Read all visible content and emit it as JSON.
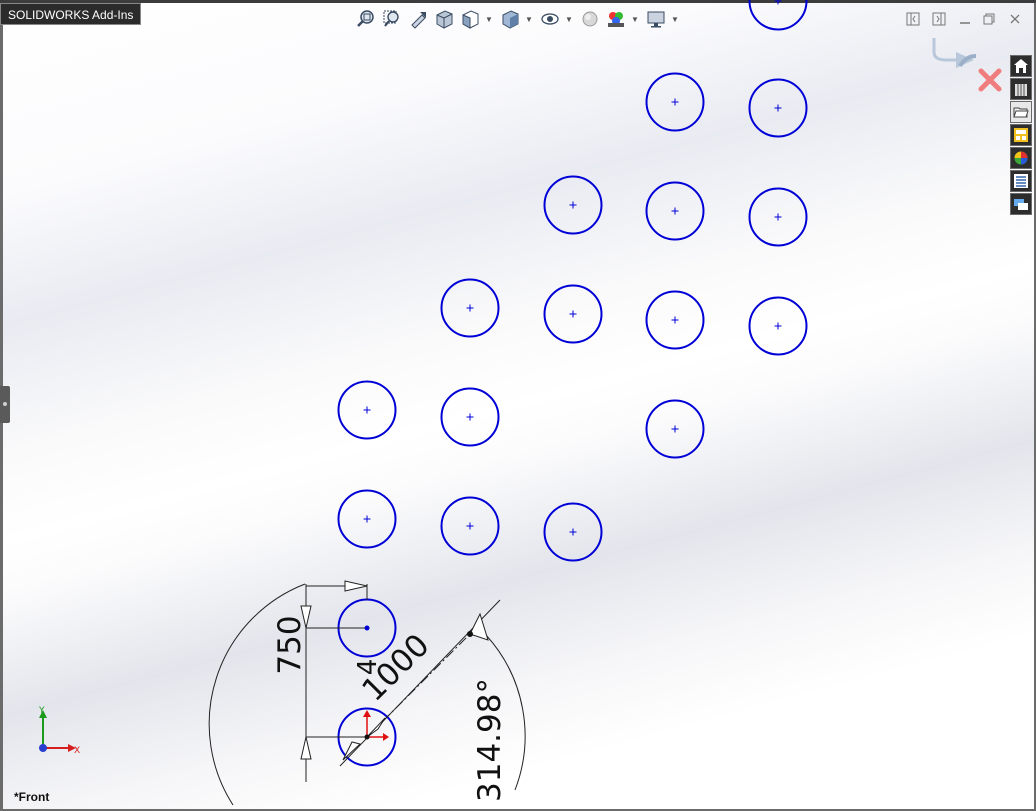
{
  "addins_tab": "SOLIDWORKS Add-Ins",
  "view_label": "*Front",
  "triad": {
    "x_label": "X",
    "y_label": "Y"
  },
  "dimensions": {
    "vertical": "750",
    "linear": "1000",
    "angle": "314.98°",
    "count": "4"
  },
  "heads_up_toolbar": [
    "zoom-to-fit-icon",
    "zoom-to-area-icon",
    "previous-view-icon",
    "section-view-icon",
    "view-orientation-icon",
    "display-style-icon",
    "hide-show-items-icon",
    "edit-appearance-icon",
    "apply-scene-icon",
    "view-settings-icon"
  ],
  "task_pane": [
    "solidworks-resources-icon",
    "design-library-icon",
    "file-explorer-icon",
    "view-palette-icon",
    "appearances-icon",
    "custom-properties-icon",
    "solidworks-forum-icon"
  ],
  "colors": {
    "sketch_blue": "#0000d6",
    "background": "#ffffff",
    "accent_red": "#e01010"
  }
}
